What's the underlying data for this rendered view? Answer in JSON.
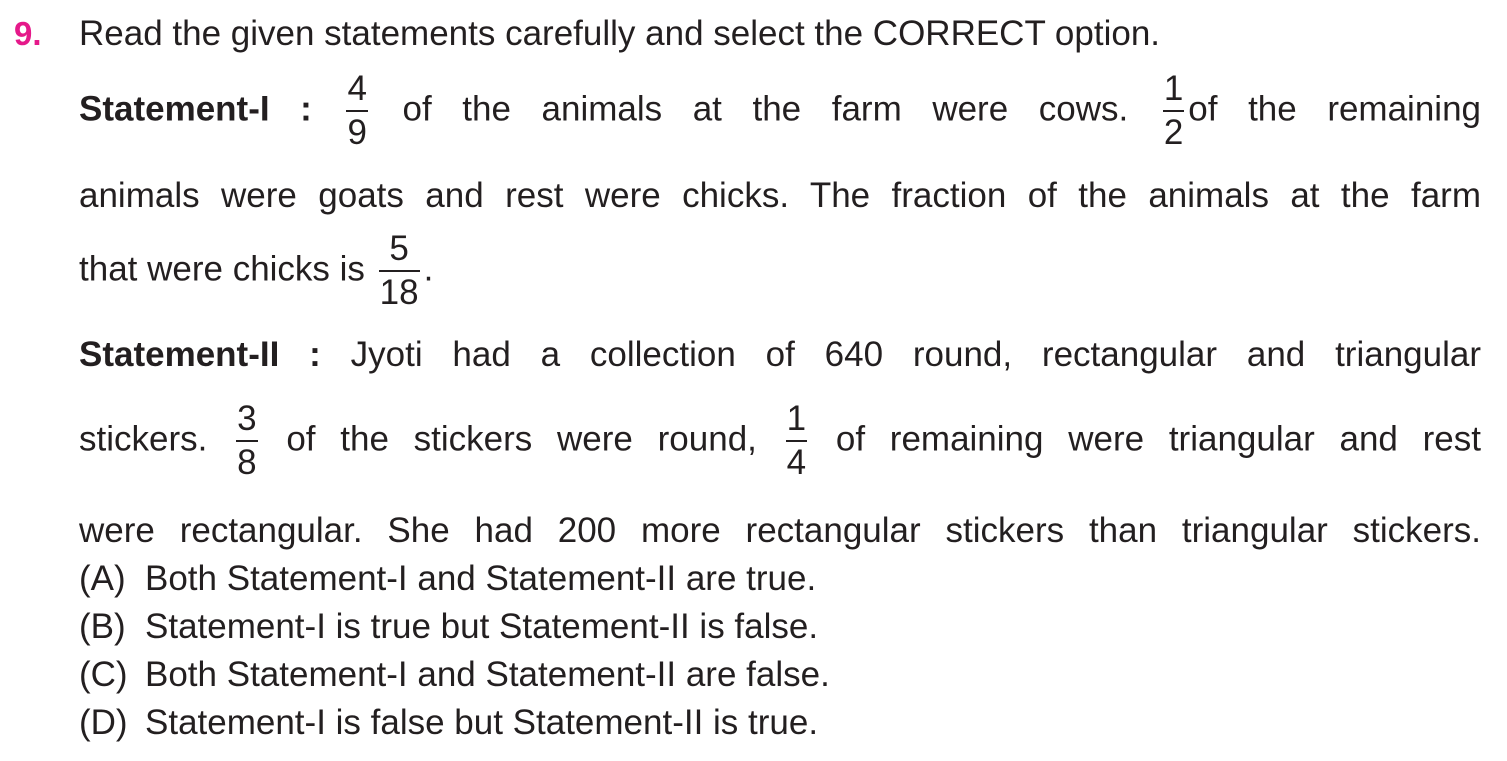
{
  "question": {
    "number": "9.",
    "prompt": "Read the given statements carefully and select the CORRECT option."
  },
  "statement1": {
    "label": "Statement-I :",
    "frac1": {
      "num": "4",
      "den": "9"
    },
    "text1": "of the animals at the farm were cows.",
    "frac2": {
      "num": "1",
      "den": "2"
    },
    "text2": "of the remaining",
    "line2": "animals were goats and rest were chicks. The fraction of the animals at the farm",
    "line3_text": "that were chicks is",
    "frac3": {
      "num": "5",
      "den": "18"
    },
    "line3_end": "."
  },
  "statement2": {
    "label": "Statement-II :",
    "text1": "Jyoti had a collection of 640 round, rectangular and triangular",
    "line2_start": "stickers.",
    "frac1": {
      "num": "3",
      "den": "8"
    },
    "line2_mid": "of the stickers were round,",
    "frac2": {
      "num": "1",
      "den": "4"
    },
    "line2_end": "of remaining were triangular and rest",
    "line3": "were rectangular. She had 200 more rectangular stickers than triangular stickers."
  },
  "options": [
    {
      "letter": "(A)",
      "text": "Both Statement-I and Statement-II are true."
    },
    {
      "letter": "(B)",
      "text": "Statement-I is true but Statement-II is false."
    },
    {
      "letter": "(C)",
      "text": "Both Statement-I and Statement-II are false."
    },
    {
      "letter": "(D)",
      "text": "Statement-I is false but Statement-II is true."
    }
  ],
  "colors": {
    "question_number": "#e5198a",
    "text": "#231f20"
  }
}
